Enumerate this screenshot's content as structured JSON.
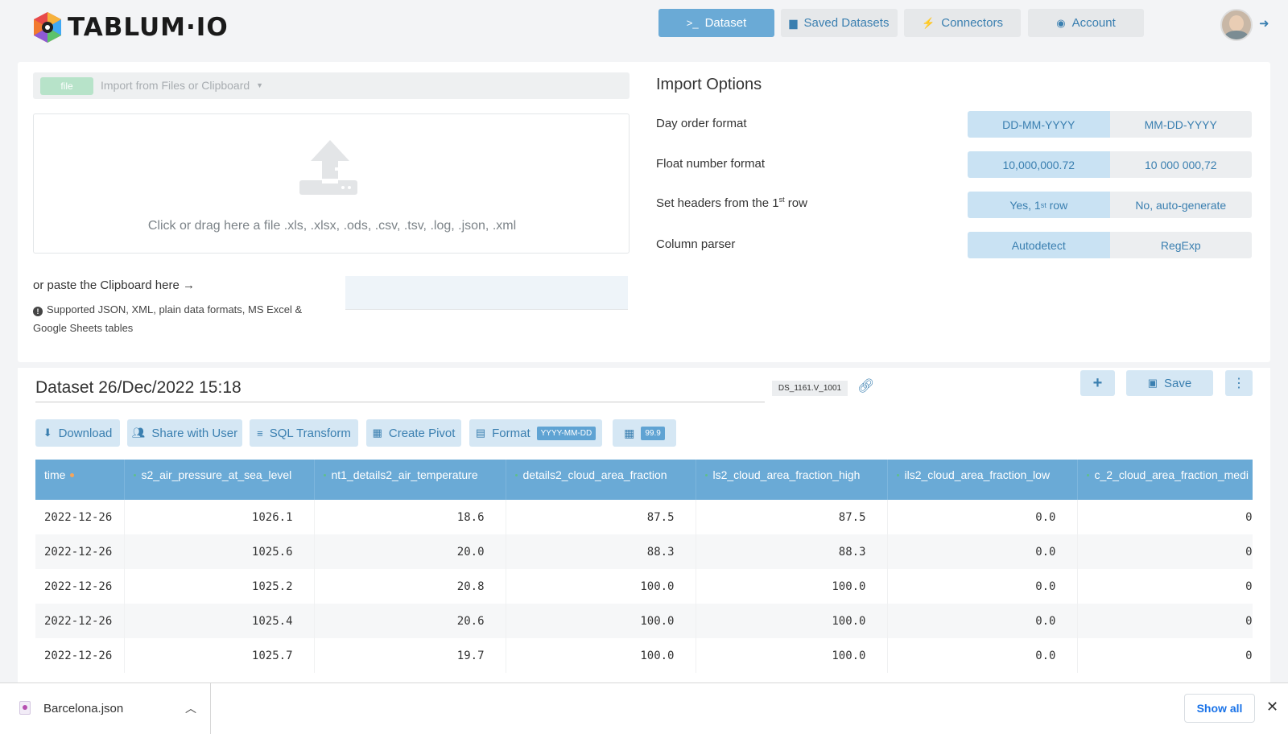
{
  "brand": {
    "name": "TABLUM·IO"
  },
  "nav": [
    {
      "label": "Dataset",
      "icon": "terminal-icon",
      "glyph": ">_",
      "active": true
    },
    {
      "label": "Saved Datasets",
      "icon": "archive-icon",
      "glyph": "▆",
      "active": false
    },
    {
      "label": "Connectors",
      "icon": "plug-icon",
      "glyph": "⚡",
      "active": false
    },
    {
      "label": "Account",
      "icon": "user-circle-icon",
      "glyph": "◉",
      "active": false
    }
  ],
  "import": {
    "file_pill": "file",
    "select_label": "Import from Files or Clipboard",
    "drop_text": "Click or drag here a file .xls, .xlsx, .ods, .csv, .tsv, .log, .json, .xml",
    "paste_label": "or paste the Clipboard here →",
    "support_note": "Supported JSON, XML, plain data formats, MS Excel & Google Sheets tables"
  },
  "options": {
    "title": "Import Options",
    "rows": [
      {
        "label": "Day order format",
        "a": "DD-MM-YYYY",
        "b": "MM-DD-YYYY"
      },
      {
        "label": "Float number format",
        "a": "10,000,000.72",
        "b": "10 000 000,72"
      },
      {
        "label": "Set headers from the 1",
        "label_sup": "st",
        "label_tail": " row",
        "a": "Yes, 1",
        "a_sup": "st",
        "a_tail": " row",
        "b": "No, auto-generate"
      },
      {
        "label": "Column parser",
        "a": "Autodetect",
        "b": "RegExp"
      }
    ]
  },
  "dataset": {
    "title": "Dataset 26/Dec/2022 15:18",
    "tag": "DS_1161.V_1001",
    "save_label": "Save",
    "plus_label": "+",
    "more_label": "⋮",
    "toolbar": {
      "download": "Download",
      "share": "Share with User",
      "sql": "SQL Transform",
      "pivot": "Create Pivot",
      "format": "Format",
      "format_badge": "YYYY-MM-DD",
      "number_badge": "99.9"
    },
    "columns": [
      "time",
      "s2_air_pressure_at_sea_level",
      "nt1_details2_air_temperature",
      "details2_cloud_area_fraction",
      "ls2_cloud_area_fraction_high",
      "ils2_cloud_area_fraction_low",
      "c_2_cloud_area_fraction_medi"
    ],
    "rows": [
      [
        "2022-12-26",
        "1026.1",
        "18.6",
        "87.5",
        "87.5",
        "0.0",
        "0"
      ],
      [
        "2022-12-26",
        "1025.6",
        "20.0",
        "88.3",
        "88.3",
        "0.0",
        "0"
      ],
      [
        "2022-12-26",
        "1025.2",
        "20.8",
        "100.0",
        "100.0",
        "0.0",
        "0"
      ],
      [
        "2022-12-26",
        "1025.4",
        "20.6",
        "100.0",
        "100.0",
        "0.0",
        "0"
      ],
      [
        "2022-12-26",
        "1025.7",
        "19.7",
        "100.0",
        "100.0",
        "0.0",
        "0"
      ]
    ]
  },
  "downloads": {
    "file_name": "Barcelona.json",
    "show_all": "Show all"
  },
  "colors": {
    "accent": "#6aaad6",
    "accent_text": "#3a7fb0",
    "light_accent": "#d5e7f4",
    "file_pill": "#b7e3c9"
  }
}
